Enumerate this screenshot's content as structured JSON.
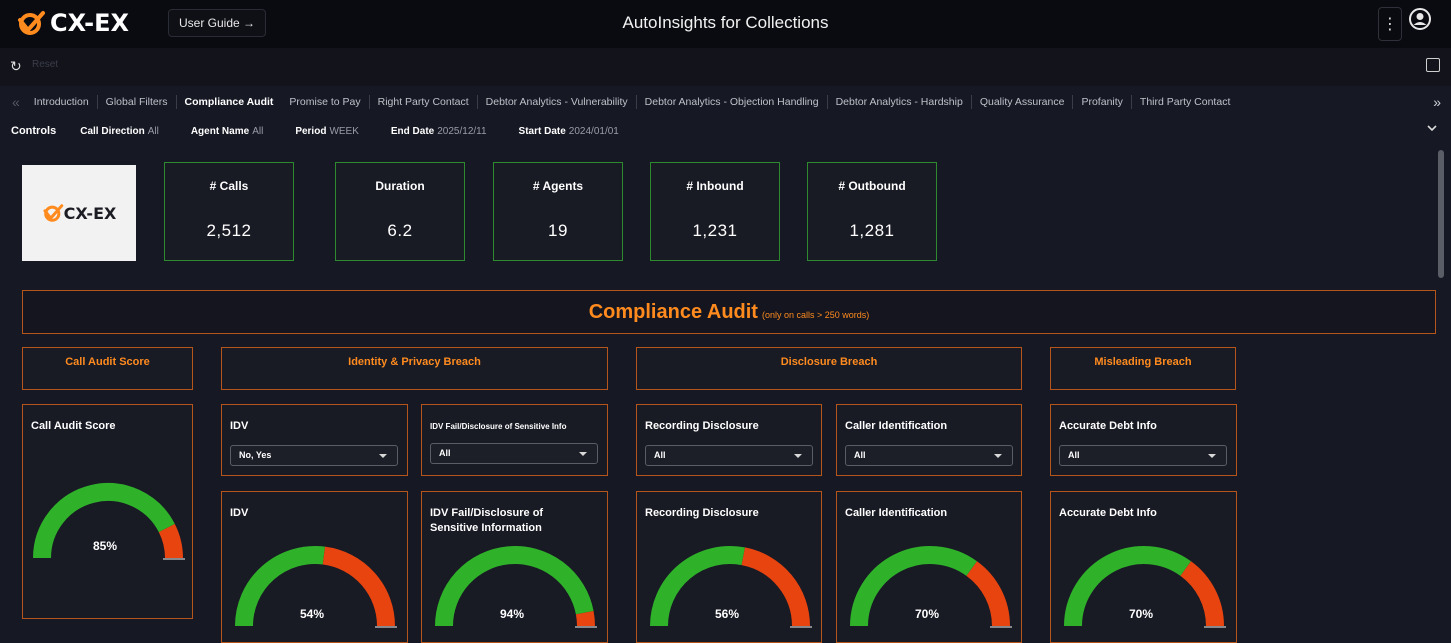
{
  "header": {
    "logo_text": "CX-EX",
    "user_guide_label": "User Guide →",
    "title": "AutoInsights for Collections"
  },
  "subbar": {
    "faint_text": "Reset"
  },
  "tabs": [
    {
      "label": "Introduction",
      "active": false
    },
    {
      "label": "Global Filters",
      "active": false
    },
    {
      "label": "Compliance Audit",
      "active": true
    },
    {
      "label": "Promise to Pay",
      "active": false
    },
    {
      "label": "Right Party Contact",
      "active": false
    },
    {
      "label": "Debtor Analytics - Vulnerability",
      "active": false
    },
    {
      "label": "Debtor Analytics - Objection Handling",
      "active": false
    },
    {
      "label": "Debtor Analytics - Hardship",
      "active": false
    },
    {
      "label": "Quality Assurance",
      "active": false
    },
    {
      "label": "Profanity",
      "active": false
    },
    {
      "label": "Third Party Contact",
      "active": false
    }
  ],
  "controls": {
    "title": "Controls",
    "items": [
      {
        "label": "Call Direction",
        "value": "All"
      },
      {
        "label": "Agent Name",
        "value": "All"
      },
      {
        "label": "Period",
        "value": "WEEK"
      },
      {
        "label": "End Date",
        "value": "2025/12/11"
      },
      {
        "label": "Start Date",
        "value": "2024/01/01"
      }
    ]
  },
  "kpis": [
    {
      "label": "# Calls",
      "value": "2,512"
    },
    {
      "label": "Duration",
      "value": "6.2"
    },
    {
      "label": "# Agents",
      "value": "19"
    },
    {
      "label": "# Inbound",
      "value": "1,231"
    },
    {
      "label": "# Outbound",
      "value": "1,281"
    }
  ],
  "banner": {
    "title": "Compliance Audit",
    "note": "(only on calls > 250 words)"
  },
  "sections": {
    "call_audit": "Call Audit Score",
    "identity": "Identity & Privacy Breach",
    "disclosure": "Disclosure Breach",
    "misleading": "Misleading Breach"
  },
  "filters": {
    "idv": {
      "title": "IDV",
      "value": "No, Yes"
    },
    "idv_fail": {
      "title": "IDV Fail/Disclosure of Sensitive Info",
      "value": "All"
    },
    "recording": {
      "title": "Recording Disclosure",
      "value": "All"
    },
    "caller": {
      "title": "Caller Identification",
      "value": "All"
    },
    "debt": {
      "title": "Accurate Debt Info",
      "value": "All"
    }
  },
  "gauges": {
    "call_audit": {
      "title": "Call Audit Score",
      "value": 85,
      "label": "85%"
    },
    "idv": {
      "title": "IDV",
      "value": 54,
      "label": "54%"
    },
    "idv_fail": {
      "title": "IDV Fail/Disclosure of Sensitive Information",
      "value": 94,
      "label": "94%"
    },
    "recording": {
      "title": "Recording Disclosure",
      "value": 56,
      "label": "56%"
    },
    "caller": {
      "title": "Caller Identification",
      "value": 70,
      "label": "70%"
    },
    "debt": {
      "title": "Accurate Debt Info",
      "value": 70,
      "label": "70%"
    }
  },
  "colors": {
    "accent": "#ff8b1f",
    "good": "#2fb12a",
    "bad": "#e8440f",
    "kpi_border": "#2d8a2f"
  }
}
